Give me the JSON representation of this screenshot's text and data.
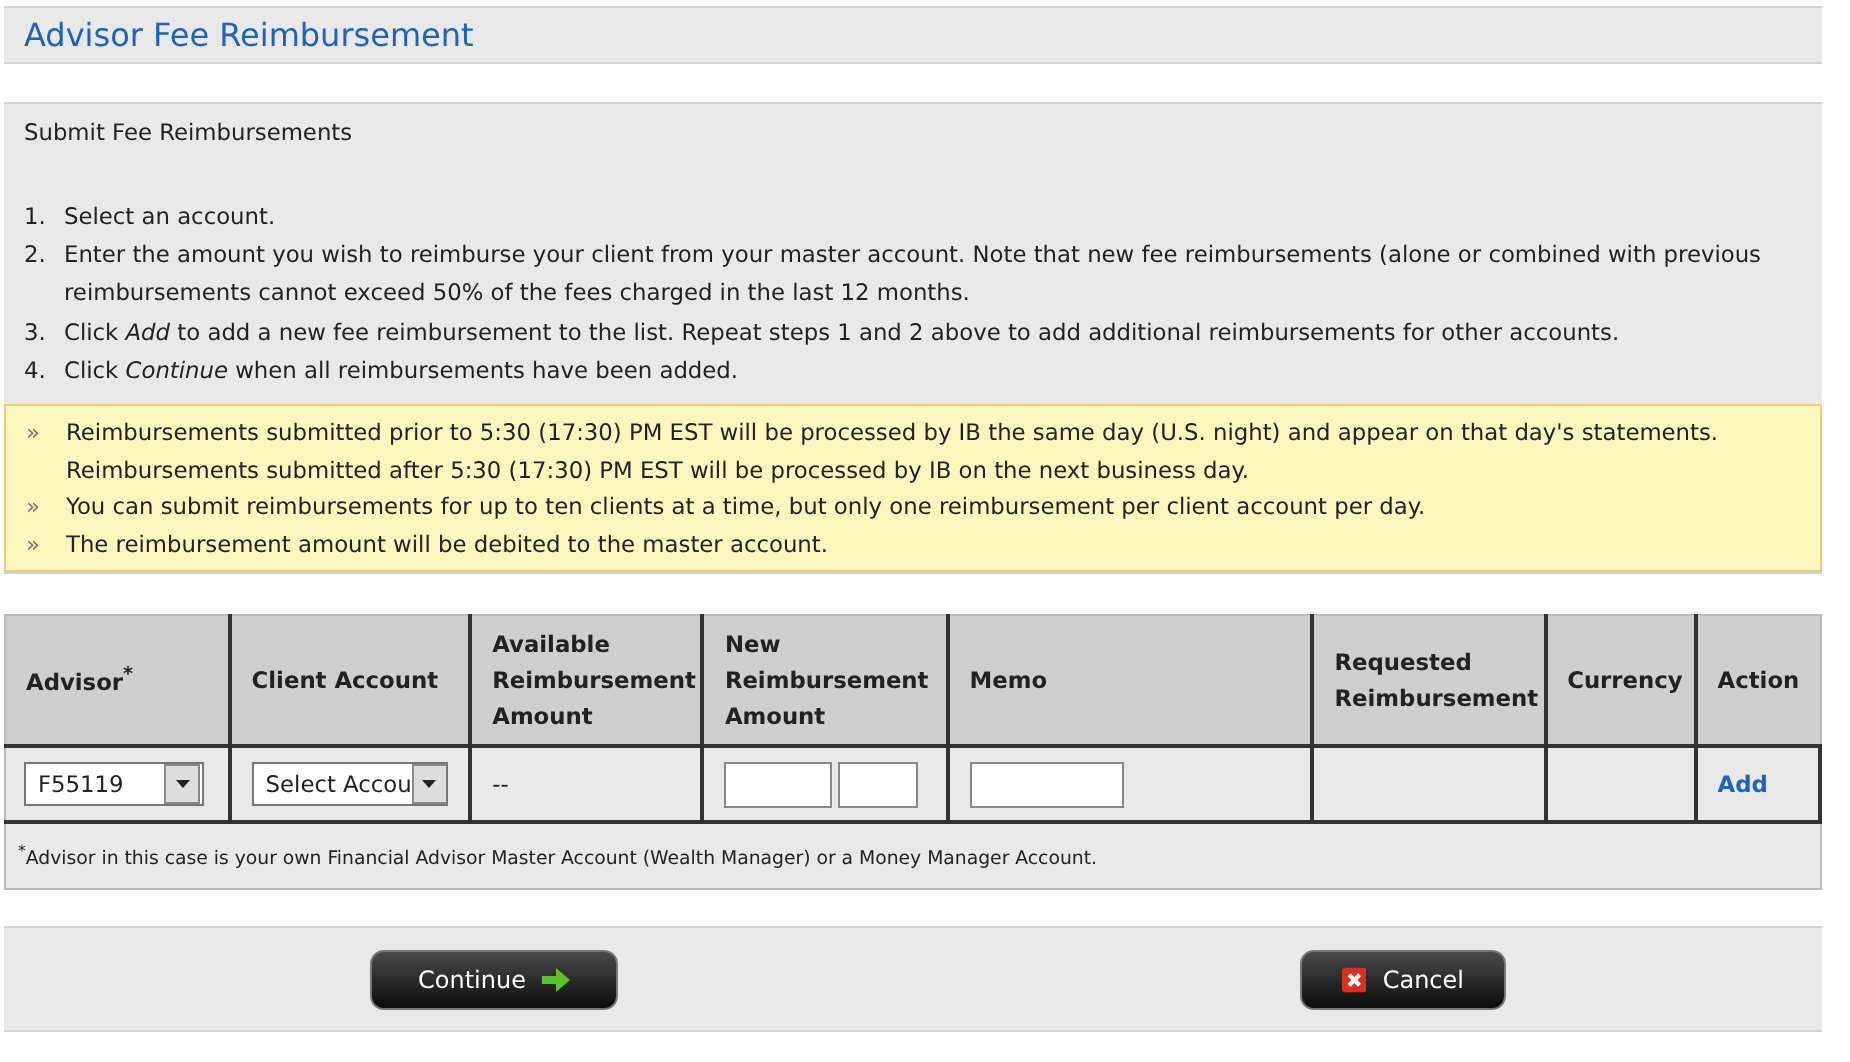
{
  "title": "Advisor Fee Reimbursement",
  "instructions": {
    "heading": "Submit Fee Reimbursements",
    "steps": [
      {
        "number": "1.",
        "text": "Select an account."
      },
      {
        "number": "2.",
        "text": "Enter the amount you wish to reimburse your client from your master account. Note that new fee reimbursements (alone or combined with previous reimbursements cannot exceed 50% of the fees charged in the last 12 months."
      },
      {
        "number": "3.",
        "text": "Click *Add* to add a new fee reimbursement to the list. Repeat steps 1 and 2 above to add additional reimbursements for other accounts."
      },
      {
        "number": "4.",
        "text": "Click *Continue* when all reimbursements have been added."
      }
    ]
  },
  "notes": [
    {
      "marker": "»",
      "lines": [
        "Reimbursements submitted prior to 5:30 (17:30) PM EST will be processed by IB the same day (U.S. night) and appear on that day's statements.",
        "Reimbursements submitted after 5:30 (17:30) PM EST will be processed by IB on the next business day."
      ]
    },
    {
      "marker": "»",
      "lines": [
        "You can submit reimbursements for up to ten clients at a time, but only one reimbursement per client account per day."
      ]
    },
    {
      "marker": "»",
      "lines": [
        "The reimbursement amount will be debited to the master account."
      ]
    }
  ],
  "table": {
    "columns": [
      "Advisor$^{*}$",
      "Client Account",
      "Available Reimbursement Amount",
      "New Reimbursement Amount",
      "Memo",
      "Requested Reimbursement",
      "Currency",
      "Action"
    ],
    "row": {
      "advisor": "F55119",
      "client_account": "Select Accou",
      "available": "--",
      "action": "Add"
    },
    "footnote": "$^{*}$Advisor in this case is your own Financial Advisor Master Account (Wealth Manager) or a Money Manager Account."
  },
  "buttons": [
    {
      "kind": "continue",
      "label": "Continue"
    },
    {
      "kind": "cancel",
      "label": "Cancel"
    }
  ]
}
